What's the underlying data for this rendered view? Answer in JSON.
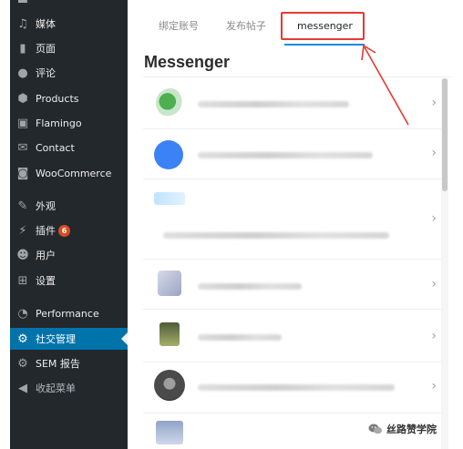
{
  "sidebar": {
    "items": [
      {
        "icon": "media-icon",
        "glyph": "♫",
        "label": "媒体"
      },
      {
        "icon": "page-icon",
        "glyph": "▮",
        "label": "页面"
      },
      {
        "icon": "comment-icon",
        "glyph": "●",
        "label": "评论"
      },
      {
        "icon": "products-icon",
        "glyph": "⬢",
        "label": "Products"
      },
      {
        "icon": "flamingo-icon",
        "glyph": "▣",
        "label": "Flamingo"
      },
      {
        "icon": "mail-icon",
        "glyph": "✉",
        "label": "Contact"
      },
      {
        "icon": "woo-icon",
        "glyph": "◙",
        "label": "WooCommerce"
      },
      {
        "icon": "brush-icon",
        "glyph": "✎",
        "label": "外观"
      },
      {
        "icon": "plugin-icon",
        "glyph": "⚡",
        "label": "插件",
        "badge": "6"
      },
      {
        "icon": "user-icon",
        "glyph": "☻",
        "label": "用户"
      },
      {
        "icon": "settings-icon",
        "glyph": "⊞",
        "label": "设置"
      },
      {
        "icon": "performance-icon",
        "glyph": "◔",
        "label": "Performance"
      },
      {
        "icon": "gear-icon",
        "glyph": "⚙",
        "label": "社交管理",
        "active": true
      },
      {
        "icon": "gear-icon",
        "glyph": "⚙",
        "label": "SEM 报告"
      },
      {
        "icon": "collapse-icon",
        "glyph": "◀",
        "label": "收起菜单"
      }
    ]
  },
  "tabs": {
    "bind_account": "绑定账号",
    "publish_post": "发布帖子",
    "messenger": "messenger"
  },
  "main": {
    "title": "Messenger"
  },
  "colors": {
    "sidebar_bg": "#23282d",
    "active_menu": "#0073aa",
    "tab_active_underline": "#1e88e5",
    "annotation_red": "#e53935",
    "badge": "#d54e21"
  },
  "watermark": {
    "label": "丝路赞学院"
  }
}
